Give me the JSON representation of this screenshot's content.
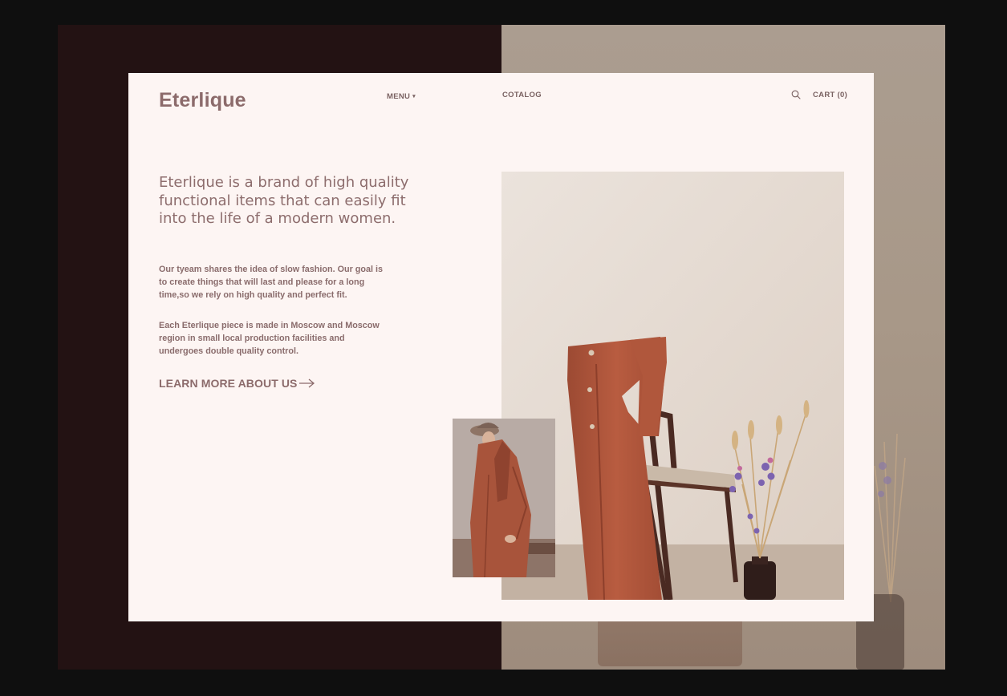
{
  "header": {
    "logo": "Eterlique",
    "nav_menu": "MENU",
    "nav_catalog": "COTALOG",
    "cart": "CART (0)"
  },
  "hero": {
    "headline": "Eterlique is a brand of high quality functional items that can easily fit into the life of a modern women.",
    "paragraph_1": "Our tyeam shares the idea of slow fashion. Our goal is to create things that will last and please for a long time,so we rely on high quality and perfect fit.",
    "paragraph_2": "Each Eterlique piece is made in Moscow and Moscow region in small local production facilities and undergoes double quality control.",
    "cta": "LEARN MORE ABOUT US"
  },
  "icons": {
    "search": "search-icon",
    "menu_caret": "chevron-down-icon",
    "cta_arrow": "arrow-right-icon"
  },
  "colors": {
    "page_bg": "#0f0f0f",
    "left_panel": "#231213",
    "card": "#fdf5f3",
    "brand_text": "#8c6b6b",
    "coat": "#b5573e"
  }
}
